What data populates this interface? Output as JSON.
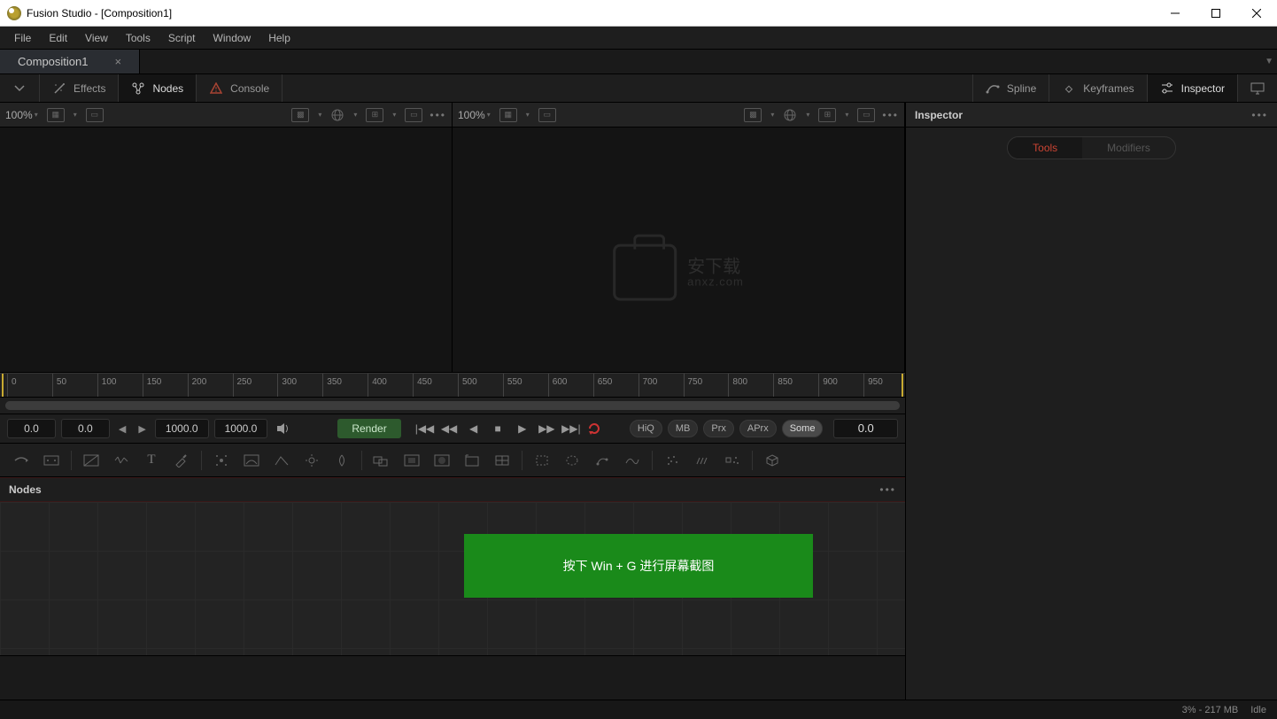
{
  "window": {
    "title": "Fusion Studio - [Composition1]"
  },
  "menu": {
    "items": [
      "File",
      "Edit",
      "View",
      "Tools",
      "Script",
      "Window",
      "Help"
    ]
  },
  "tab": {
    "name": "Composition1"
  },
  "toolbar": {
    "effects": "Effects",
    "nodes": "Nodes",
    "console": "Console",
    "spline": "Spline",
    "keyframes": "Keyframes",
    "inspector": "Inspector"
  },
  "viewer": {
    "zoom1": "100%",
    "zoom2": "100%"
  },
  "watermark": {
    "line1": "安下载",
    "line2": "anxz.com"
  },
  "inspector": {
    "title": "Inspector",
    "tabs": {
      "tools": "Tools",
      "modifiers": "Modifiers"
    }
  },
  "ruler": {
    "ticks": [
      "0",
      "50",
      "100",
      "150",
      "200",
      "250",
      "300",
      "350",
      "400",
      "450",
      "500",
      "550",
      "600",
      "650",
      "700",
      "750",
      "800",
      "850",
      "900",
      "950"
    ]
  },
  "transport": {
    "in": "0.0",
    "cur": "0.0",
    "out": "1000.0",
    "dur": "1000.0",
    "render": "Render",
    "time": "0.0",
    "hiq": "HiQ",
    "mb": "MB",
    "prx": "Prx",
    "aprx": "APrx",
    "some": "Some"
  },
  "nodes": {
    "title": "Nodes"
  },
  "toast": {
    "text": "按下 Win + G 进行屏幕截图"
  },
  "status": {
    "mem": "3% - 217 MB",
    "state": "Idle"
  }
}
